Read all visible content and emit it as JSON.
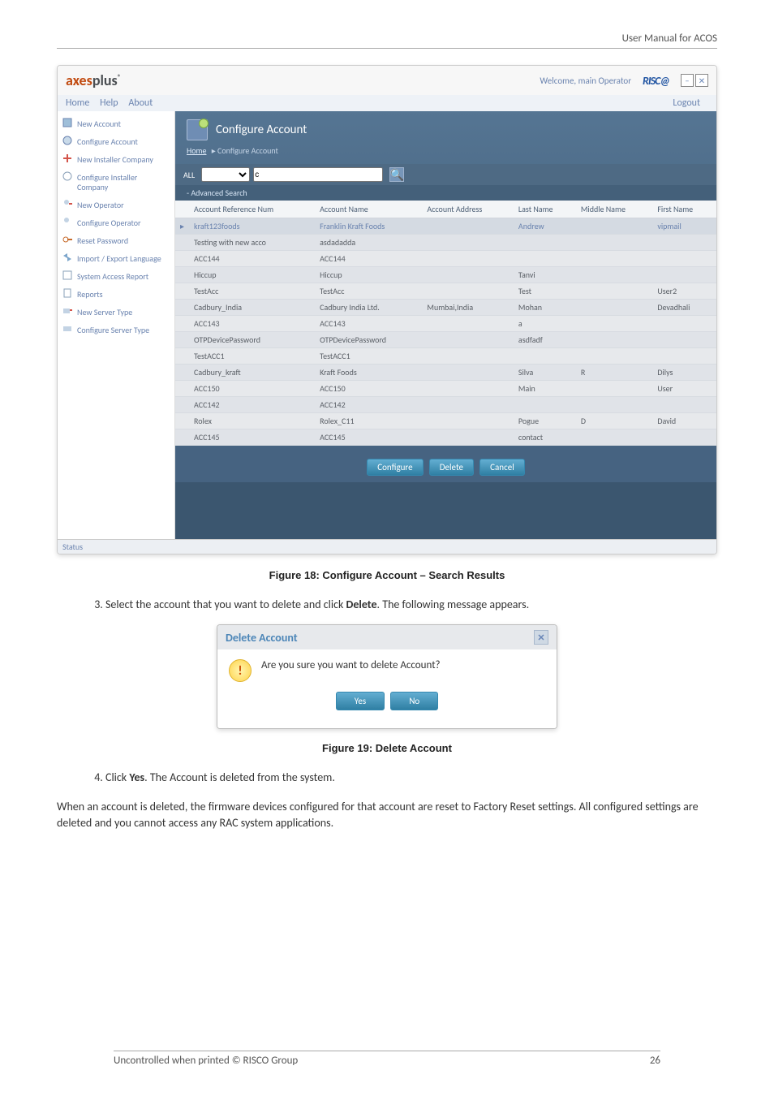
{
  "page_header": "User Manual for ACOS",
  "brand_prefix": "axes",
  "brand_suffix": "plus",
  "brand_reg": "®",
  "welcome": "Welcome, main Operator",
  "logo": "RISC@",
  "menu": {
    "home": "Home",
    "help": "Help",
    "about": "About",
    "logout": "Logout"
  },
  "sidebar": {
    "items": [
      "New Account",
      "Configure Account",
      "New Installer Company",
      "Configure Installer Company",
      "New Operator",
      "Configure Operator",
      "Reset Password",
      "Import / Export Language",
      "System Access Report",
      "Reports",
      "New Server Type",
      "Configure Server Type"
    ]
  },
  "main": {
    "title": "Configure Account",
    "bc_home": "Home",
    "bc_current": "Configure Account",
    "tb_all": "ALL",
    "tb_in": "c",
    "advsearch": "- Advanced Search",
    "cols": [
      "Account Reference Num",
      "Account Name",
      "Account Address",
      "Last Name",
      "Middle Name",
      "First Name"
    ],
    "rows": [
      {
        "ref": "kraft123foods",
        "name": "Franklin Kraft Foods",
        "addr": "",
        "last": "Andrew",
        "mid": "",
        "first": "vipmail",
        "hl": true,
        "exp": "▸"
      },
      {
        "ref": "Testing with new acco",
        "name": "asdadadda",
        "addr": "",
        "last": "",
        "mid": "",
        "first": "",
        "shade": true
      },
      {
        "ref": "ACC144",
        "name": "ACC144",
        "addr": "",
        "last": "",
        "mid": "",
        "first": ""
      },
      {
        "ref": "Hiccup",
        "name": "Hiccup",
        "addr": "",
        "last": "Tanvi",
        "mid": "",
        "first": "",
        "shade": true
      },
      {
        "ref": "TestAcc",
        "name": "TestAcc",
        "addr": "",
        "last": "Test",
        "mid": "",
        "first": "User2"
      },
      {
        "ref": "Cadbury_India",
        "name": "Cadbury India Ltd.",
        "addr": "Mumbai,India",
        "last": "Mohan",
        "mid": "",
        "first": "Devadhali",
        "shade": true
      },
      {
        "ref": "ACC143",
        "name": "ACC143",
        "addr": "",
        "last": "a",
        "mid": "",
        "first": ""
      },
      {
        "ref": "OTPDevicePassword",
        "name": "OTPDevicePassword",
        "addr": "",
        "last": "asdfadf",
        "mid": "",
        "first": "",
        "shade": true
      },
      {
        "ref": "TestACC1",
        "name": "TestACC1",
        "addr": "",
        "last": "",
        "mid": "",
        "first": ""
      },
      {
        "ref": "Cadbury_kraft",
        "name": "Kraft Foods",
        "addr": "",
        "last": "Silva",
        "mid": "R",
        "first": "Dilys",
        "shade": true
      },
      {
        "ref": "ACC150",
        "name": "ACC150",
        "addr": "",
        "last": "Main",
        "mid": "",
        "first": "User"
      },
      {
        "ref": "ACC142",
        "name": "ACC142",
        "addr": "",
        "last": "",
        "mid": "",
        "first": "",
        "shade": true
      },
      {
        "ref": "Rolex",
        "name": "Rolex_C11",
        "addr": "",
        "last": "Pogue",
        "mid": "D",
        "first": "David"
      },
      {
        "ref": "ACC145",
        "name": "ACC145",
        "addr": "",
        "last": "contact",
        "mid": "",
        "first": "",
        "shade": true
      }
    ],
    "btn_configure": "Configure",
    "btn_delete": "Delete",
    "btn_cancel": "Cancel"
  },
  "status": "Status",
  "fig18": "Figure 18: Configure Account – Search Results",
  "step3": "Select the account that you want to delete and click ",
  "step3_bold": "Delete",
  "step3_tail": ". The following message appears.",
  "dialog": {
    "title": "Delete Account",
    "msg": "Are you sure you want to delete Account?",
    "yes": "Yes",
    "no": "No"
  },
  "fig19": "Figure 19: Delete Account",
  "step4_pre": "Click ",
  "step4_bold": "Yes",
  "step4_tail": ". The Account is deleted from the system.",
  "body1": "When an account is deleted, the firmware devices configured for that account are reset to Factory Reset settings. All configured settings are deleted and you cannot access any RAC system applications.",
  "footer_left": "Uncontrolled when printed © RISCO Group",
  "footer_page": "26"
}
